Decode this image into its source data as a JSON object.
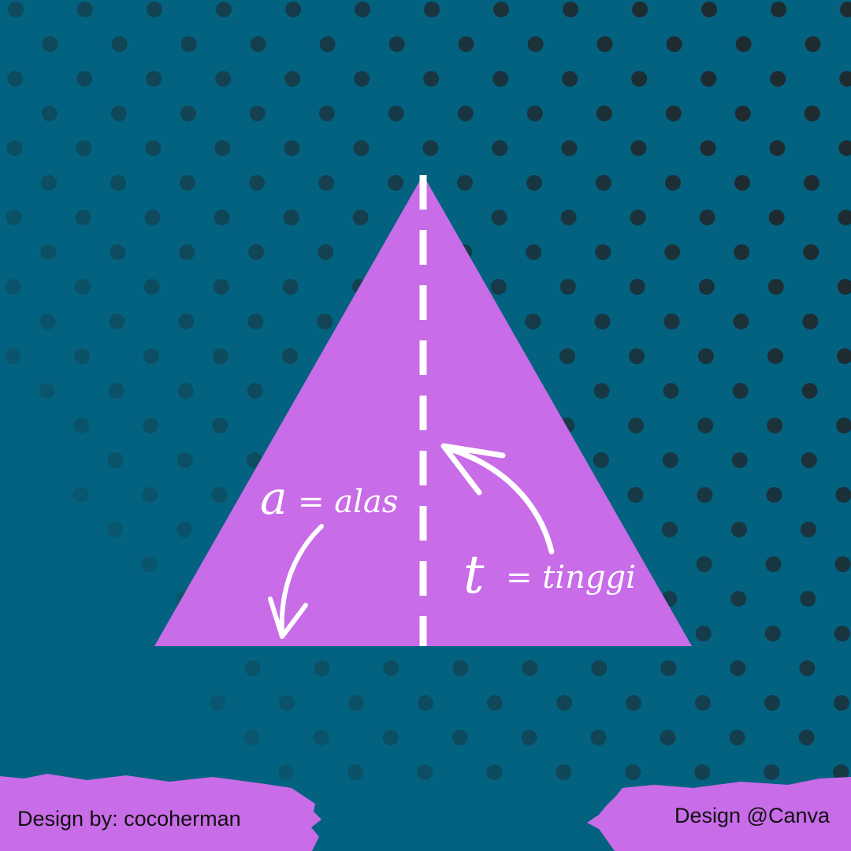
{
  "colors": {
    "background": "#03627f",
    "dot": "#1f2a30",
    "triangle": "#c86ce8",
    "brush": "#c86ce8",
    "stroke": "#ffffff"
  },
  "labels": {
    "base_symbol": "a",
    "base_text": "= alas",
    "height_symbol": "t",
    "height_text": "= tinggi"
  },
  "credits": {
    "left": "Design by: cocoherman",
    "right": "Design @Canva"
  }
}
